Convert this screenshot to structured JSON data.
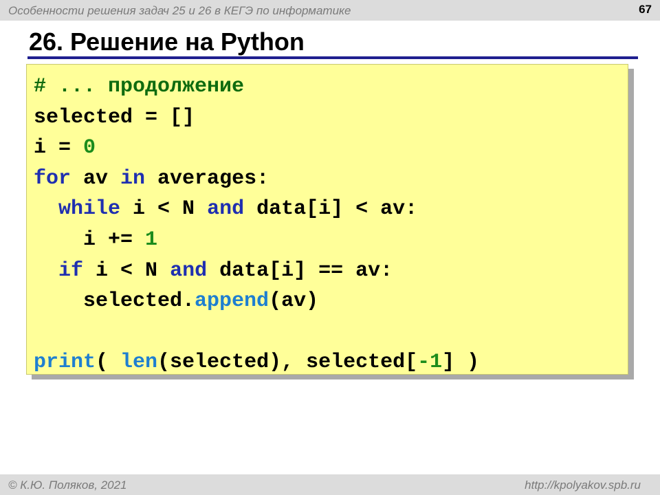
{
  "header": {
    "subtitle": "Особенности решения задач 25 и 26 в КЕГЭ по информатике",
    "page_number": "67"
  },
  "slide": {
    "title": "26. Решение на Python"
  },
  "code": {
    "lines": [
      [
        {
          "t": "# ... продолжение",
          "c": "cm"
        }
      ],
      [
        {
          "t": "selected = []"
        }
      ],
      [
        {
          "t": "i = "
        },
        {
          "t": "0",
          "c": "num"
        }
      ],
      [
        {
          "t": "for",
          "c": "kw"
        },
        {
          "t": " av "
        },
        {
          "t": "in",
          "c": "kw"
        },
        {
          "t": " averages:"
        }
      ],
      [
        {
          "t": "  "
        },
        {
          "t": "while",
          "c": "kw"
        },
        {
          "t": " i < N "
        },
        {
          "t": "and",
          "c": "kw"
        },
        {
          "t": " data[i] < av:"
        }
      ],
      [
        {
          "t": "    i += "
        },
        {
          "t": "1",
          "c": "num"
        }
      ],
      [
        {
          "t": "  "
        },
        {
          "t": "if",
          "c": "kw"
        },
        {
          "t": " i < N "
        },
        {
          "t": "and",
          "c": "kw"
        },
        {
          "t": " data[i] == av:"
        }
      ],
      [
        {
          "t": "    selected."
        },
        {
          "t": "append",
          "c": "fn"
        },
        {
          "t": "(av)"
        }
      ],
      [],
      [
        {
          "t": "print",
          "c": "fn"
        },
        {
          "t": "( "
        },
        {
          "t": "len",
          "c": "fn"
        },
        {
          "t": "(selected), selected["
        },
        {
          "t": "-1",
          "c": "num"
        },
        {
          "t": "] )"
        }
      ]
    ]
  },
  "footer": {
    "copyright": "© К.Ю. Поляков, 2021",
    "url": "http://kpolyakov.spb.ru"
  },
  "colors": {
    "code_background": "#ffff99",
    "keyword": "#1f2fb0",
    "number": "#1c8c1c",
    "function": "#1f7fd0",
    "comment": "#0f6b0f",
    "title_rule": "#1f1f8f"
  }
}
